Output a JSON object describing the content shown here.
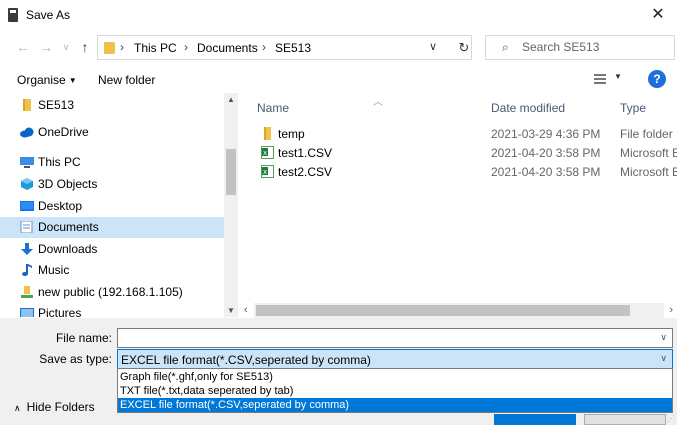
{
  "window": {
    "title": "Save As"
  },
  "nav": {
    "breadcrumbs": [
      "This PC",
      "Documents",
      "SE513"
    ],
    "search_placeholder": "Search SE513"
  },
  "toolbar": {
    "organise_label": "Organise",
    "new_folder_label": "New folder"
  },
  "sidebar": {
    "items": [
      {
        "label": "SE513",
        "icon": "folder-icon",
        "color": "#f2c14a"
      },
      {
        "label": "OneDrive",
        "icon": "cloud-icon",
        "color": "#0a64c8"
      },
      {
        "label": "This PC",
        "icon": "computer-icon",
        "color": "#3a8ee6"
      },
      {
        "label": "3D Objects",
        "icon": "cube-icon",
        "color": "#1e9bd7"
      },
      {
        "label": "Desktop",
        "icon": "desktop-icon",
        "color": "#1a73e8"
      },
      {
        "label": "Documents",
        "icon": "document-icon",
        "color": "#6a8fc0",
        "selected": true
      },
      {
        "label": "Downloads",
        "icon": "download-arrow-icon",
        "color": "#1f6fd0"
      },
      {
        "label": "Music",
        "icon": "music-note-icon",
        "color": "#2060c0"
      },
      {
        "label": "new public (192.168.1.105)",
        "icon": "network-drive-icon",
        "color": "#4aa84a"
      },
      {
        "label": "Pictures",
        "icon": "pictures-icon",
        "color": "#1e73c8"
      }
    ]
  },
  "files": {
    "columns": {
      "name": "Name",
      "date": "Date modified",
      "type": "Type"
    },
    "rows": [
      {
        "name": "temp",
        "date": "2021-03-29 4:36 PM",
        "type": "File folder",
        "icon": "folder-icon"
      },
      {
        "name": "test1.CSV",
        "date": "2021-04-20 3:58 PM",
        "type": "Microsoft Ex",
        "icon": "excel-csv-icon"
      },
      {
        "name": "test2.CSV",
        "date": "2021-04-20 3:58 PM",
        "type": "Microsoft Ex",
        "icon": "excel-csv-icon"
      }
    ]
  },
  "form": {
    "file_name_label": "File name:",
    "file_name_value": "",
    "save_as_type_label": "Save as type:",
    "save_as_type_value": "EXCEL file format(*.CSV,seperated by comma)",
    "type_options": [
      "Graph file(*.ghf,only for SE513)",
      "TXT file(*.txt,data seperated by tab)",
      "EXCEL file format(*.CSV,seperated by comma)"
    ],
    "hide_folders_label": "Hide Folders"
  },
  "colors": {
    "accent": "#0078d7",
    "selection": "#cce4f7"
  }
}
